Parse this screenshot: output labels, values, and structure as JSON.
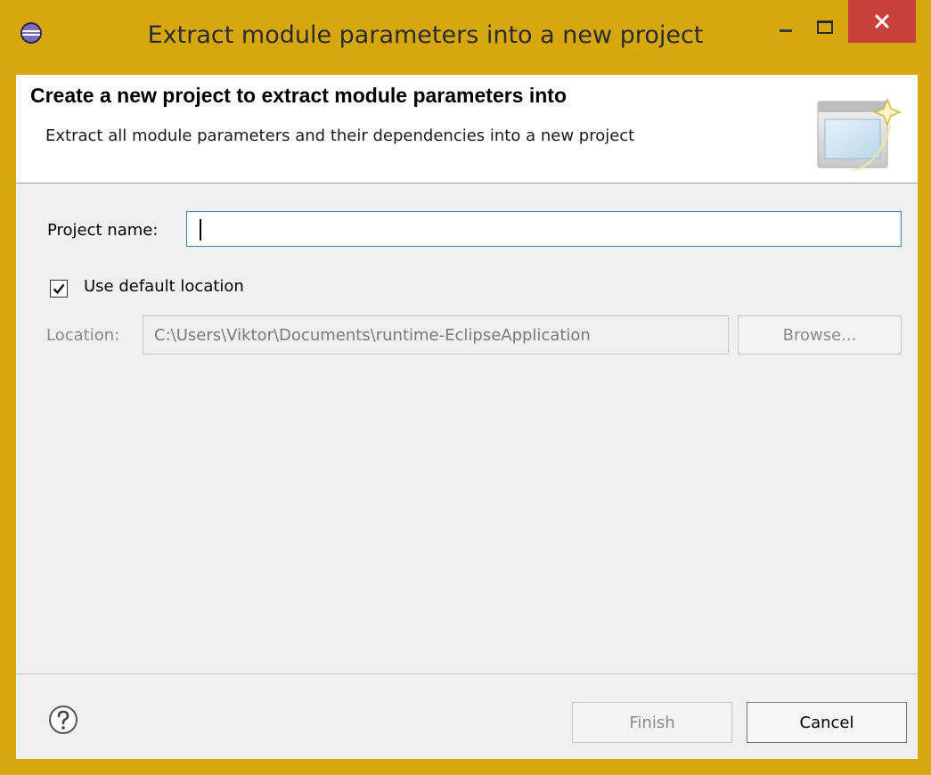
{
  "window": {
    "title": "Extract module parameters into a new project",
    "frame_color": "#d6a80e",
    "close_color": "#c7403a"
  },
  "header": {
    "title": "Create a new project to extract module parameters into",
    "description": "Extract all module parameters and their dependencies into a new project"
  },
  "form": {
    "project_name_label": "Project name:",
    "project_name_value": "",
    "use_default_label": "Use default location",
    "use_default_checked": true,
    "location_label": "Location:",
    "location_value": "C:\\Users\\Viktor\\Documents\\runtime-EclipseApplication",
    "browse_label": "Browse..."
  },
  "footer": {
    "finish_label": "Finish",
    "cancel_label": "Cancel"
  },
  "icons": {
    "app": "eclipse-icon",
    "minimize": "minimize-icon",
    "maximize": "maximize-icon",
    "close": "close-icon",
    "wizard": "new-wizard-icon",
    "help": "help-icon",
    "check": "checkmark-icon"
  }
}
